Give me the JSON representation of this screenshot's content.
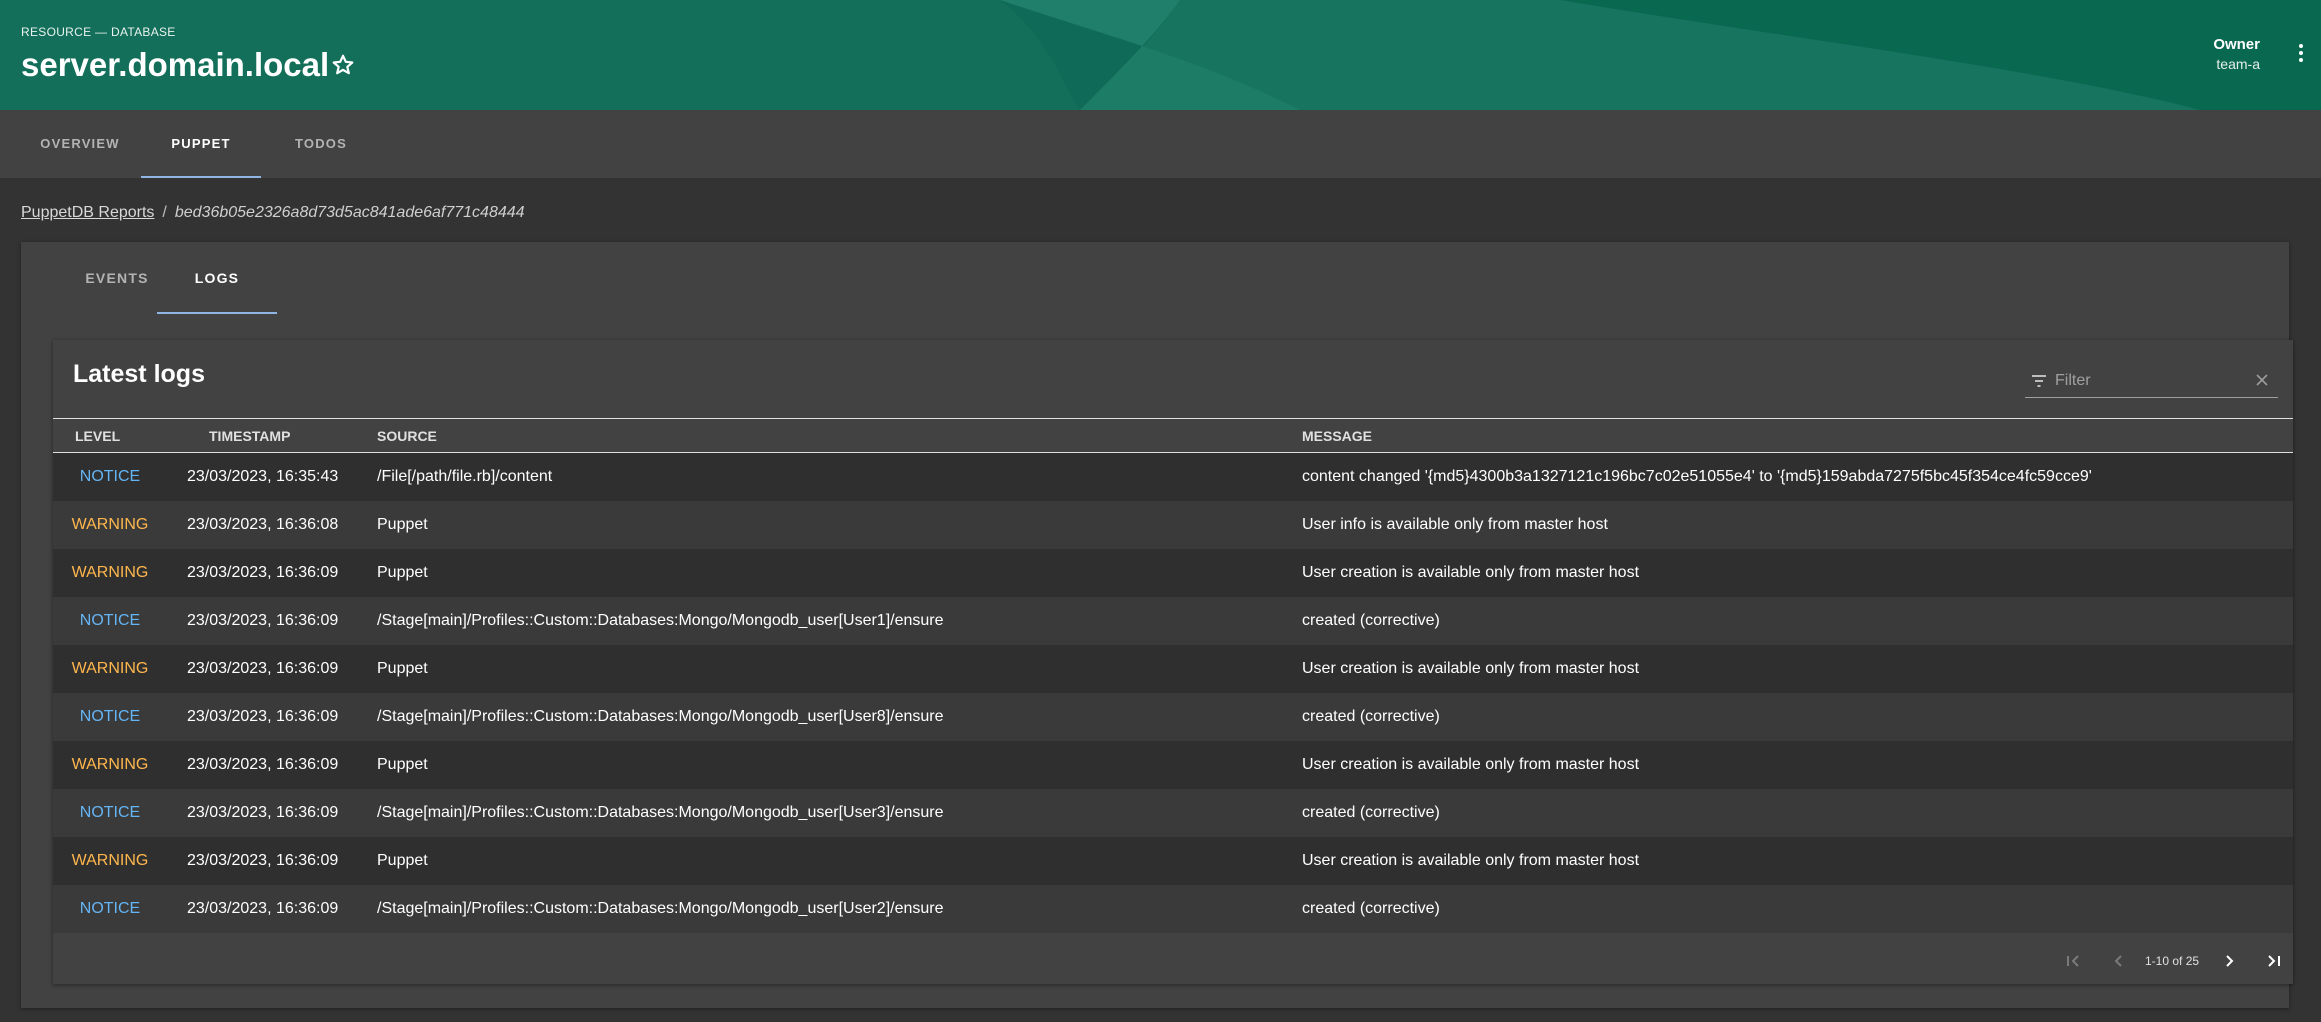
{
  "header": {
    "kind_label": "RESOURCE — DATABASE",
    "title": "server.domain.local",
    "favorite_icon": "star-outline-icon",
    "owner_label": "Owner",
    "owner_value": "team-a",
    "menu_icon": "more-vertical-icon",
    "colors": {
      "base": "#0f6b57",
      "light": "#2f8f7a",
      "dark": "#006146"
    }
  },
  "main_tabs": [
    {
      "label": "OVERVIEW",
      "active": false
    },
    {
      "label": "PUPPET",
      "active": true
    },
    {
      "label": "TODOS",
      "active": false
    }
  ],
  "breadcrumb": {
    "parent": "PuppetDB Reports",
    "separator": "/",
    "current": "bed36b05e2326a8d73d5ac841ade6af771c48444"
  },
  "report_tabs": [
    {
      "label": "EVENTS",
      "active": false
    },
    {
      "label": "LOGS",
      "active": true
    }
  ],
  "logs": {
    "title": "Latest logs",
    "filter": {
      "placeholder": "Filter",
      "value": ""
    },
    "columns": [
      "LEVEL",
      "TIMESTAMP",
      "SOURCE",
      "MESSAGE"
    ],
    "rows": [
      {
        "level": "NOTICE",
        "timestamp": "23/03/2023, 16:35:43",
        "source": "/File[/path/file.rb]/content",
        "message": "content changed '{md5}4300b3a1327121c196bc7c02e51055e4' to '{md5}159abda7275f5bc45f354ce4fc59cce9'"
      },
      {
        "level": "WARNING",
        "timestamp": "23/03/2023, 16:36:08",
        "source": "Puppet",
        "message": "User info is available only from master host"
      },
      {
        "level": "WARNING",
        "timestamp": "23/03/2023, 16:36:09",
        "source": "Puppet",
        "message": "User creation is available only from master host"
      },
      {
        "level": "NOTICE",
        "timestamp": "23/03/2023, 16:36:09",
        "source": "/Stage[main]/Profiles::Custom::Databases:Mongo/Mongodb_user[User1]/ensure",
        "message": "created (corrective)"
      },
      {
        "level": "WARNING",
        "timestamp": "23/03/2023, 16:36:09",
        "source": "Puppet",
        "message": "User creation is available only from master host"
      },
      {
        "level": "NOTICE",
        "timestamp": "23/03/2023, 16:36:09",
        "source": "/Stage[main]/Profiles::Custom::Databases:Mongo/Mongodb_user[User8]/ensure",
        "message": "created (corrective)"
      },
      {
        "level": "WARNING",
        "timestamp": "23/03/2023, 16:36:09",
        "source": "Puppet",
        "message": "User creation is available only from master host"
      },
      {
        "level": "NOTICE",
        "timestamp": "23/03/2023, 16:36:09",
        "source": "/Stage[main]/Profiles::Custom::Databases:Mongo/Mongodb_user[User3]/ensure",
        "message": "created (corrective)"
      },
      {
        "level": "WARNING",
        "timestamp": "23/03/2023, 16:36:09",
        "source": "Puppet",
        "message": "User creation is available only from master host"
      },
      {
        "level": "NOTICE",
        "timestamp": "23/03/2023, 16:36:09",
        "source": "/Stage[main]/Profiles::Custom::Databases:Mongo/Mongodb_user[User2]/ensure",
        "message": "created (corrective)"
      }
    ],
    "level_colors": {
      "NOTICE": "#64b5f6",
      "WARNING": "#ffb74d"
    },
    "pagination": {
      "range": "1-10 of 25"
    }
  }
}
